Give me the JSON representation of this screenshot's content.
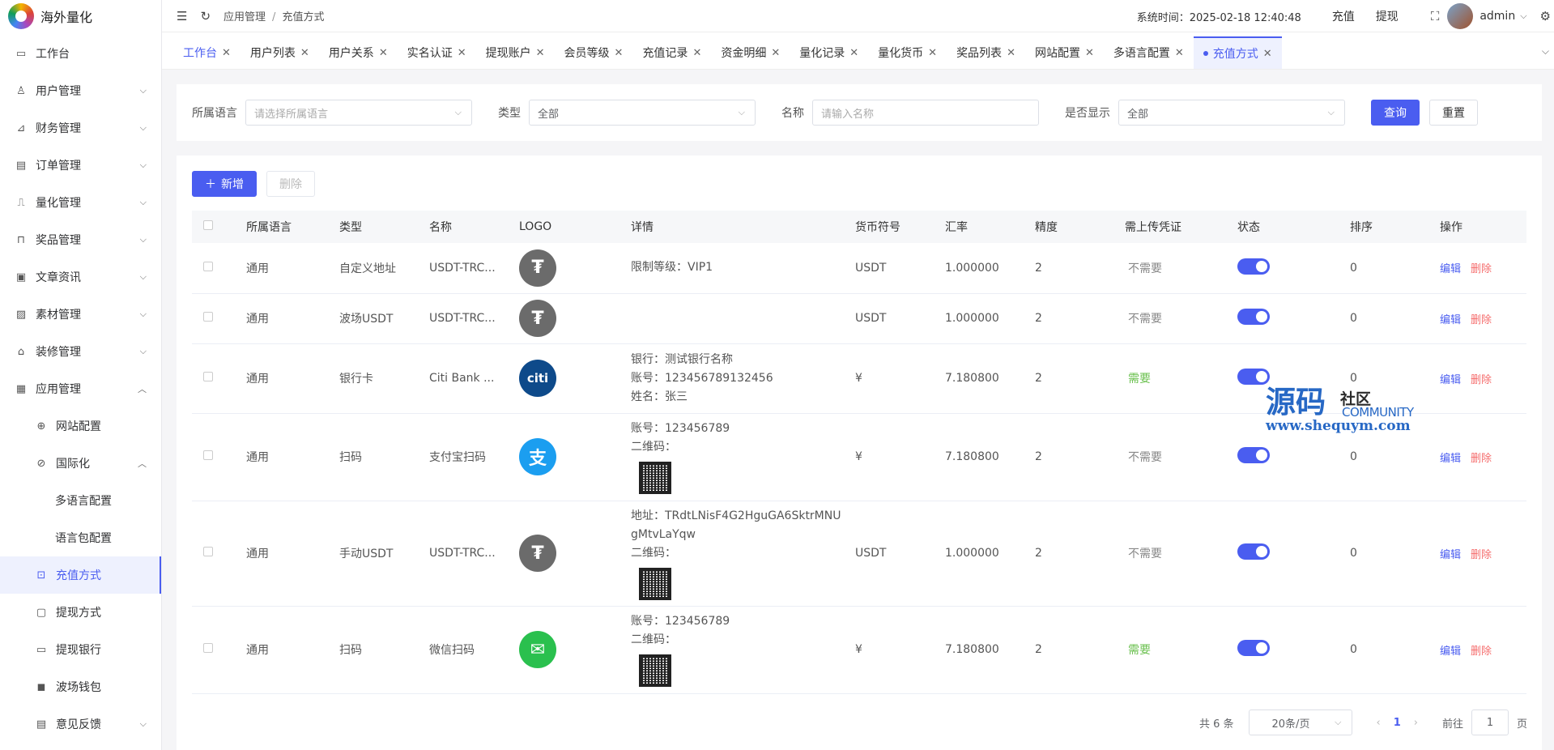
{
  "app": {
    "title": "海外量化"
  },
  "sidebar": {
    "items": [
      {
        "label": "工作台",
        "icon": "monitor-icon"
      },
      {
        "label": "用户管理",
        "icon": "user-icon"
      },
      {
        "label": "财务管理",
        "icon": "chart-icon"
      },
      {
        "label": "订单管理",
        "icon": "order-icon"
      },
      {
        "label": "量化管理",
        "icon": "quant-icon"
      },
      {
        "label": "奖品管理",
        "icon": "bag-icon"
      },
      {
        "label": "文章资讯",
        "icon": "article-icon"
      },
      {
        "label": "素材管理",
        "icon": "image-icon"
      },
      {
        "label": "装修管理",
        "icon": "decor-icon"
      },
      {
        "label": "应用管理",
        "icon": "app-icon"
      }
    ],
    "app_sub": [
      {
        "label": "网站配置"
      },
      {
        "label": "国际化"
      }
    ],
    "i18n_sub": [
      {
        "label": "多语言配置"
      },
      {
        "label": "语言包配置"
      }
    ],
    "app_sub2": [
      {
        "label": "充值方式"
      },
      {
        "label": "提现方式"
      },
      {
        "label": "提现银行"
      },
      {
        "label": "波场钱包"
      },
      {
        "label": "意见反馈"
      }
    ]
  },
  "topbar": {
    "breadcrumb": [
      "应用管理",
      "充值方式"
    ],
    "breadcrumb_sep": "/",
    "system_time_label": "系统时间：",
    "system_time": "2025-02-18 12:40:48",
    "recharge": "充值",
    "withdraw": "提现",
    "user": "admin"
  },
  "tabs": [
    "工作台",
    "用户列表",
    "用户关系",
    "实名认证",
    "提现账户",
    "会员等级",
    "充值记录",
    "资金明细",
    "量化记录",
    "量化货币",
    "奖品列表",
    "网站配置",
    "多语言配置",
    "充值方式"
  ],
  "filter": {
    "lang_label": "所属语言",
    "lang_placeholder": "请选择所属语言",
    "type_label": "类型",
    "type_value": "全部",
    "name_label": "名称",
    "name_placeholder": "请输入名称",
    "show_label": "是否显示",
    "show_value": "全部",
    "query": "查询",
    "reset": "重置"
  },
  "toolbar": {
    "add": "新增",
    "delete": "删除"
  },
  "table": {
    "headers": [
      "所属语言",
      "类型",
      "名称",
      "LOGO",
      "详情",
      "货币符号",
      "汇率",
      "精度",
      "需上传凭证",
      "状态",
      "排序",
      "操作"
    ],
    "rows": [
      {
        "lang": "通用",
        "type": "自定义地址",
        "name": "USDT-TRC...",
        "logo": "tether-logo",
        "detail": [
          "限制等级：VIP1"
        ],
        "qr": false,
        "symbol": "USDT",
        "rate": "1.000000",
        "precision": "2",
        "voucher": "不需要",
        "voucher_need": false,
        "status": true,
        "sort": "0"
      },
      {
        "lang": "通用",
        "type": "波场USDT",
        "name": "USDT-TRC...",
        "logo": "tether-logo",
        "detail": [],
        "qr": false,
        "symbol": "USDT",
        "rate": "1.000000",
        "precision": "2",
        "voucher": "不需要",
        "voucher_need": false,
        "status": true,
        "sort": "0"
      },
      {
        "lang": "通用",
        "type": "银行卡",
        "name": "Citi Bank ...",
        "logo": "citi-logo",
        "detail": [
          "银行：测试银行名称",
          "账号：123456789132456",
          "姓名：张三"
        ],
        "qr": false,
        "symbol": "¥",
        "rate": "7.180800",
        "precision": "2",
        "voucher": "需要",
        "voucher_need": true,
        "status": true,
        "sort": "0"
      },
      {
        "lang": "通用",
        "type": "扫码",
        "name": "支付宝扫码",
        "logo": "alipay-logo",
        "detail": [
          "账号：123456789",
          "二维码："
        ],
        "qr": true,
        "symbol": "¥",
        "rate": "7.180800",
        "precision": "2",
        "voucher": "不需要",
        "voucher_need": false,
        "status": true,
        "sort": "0"
      },
      {
        "lang": "通用",
        "type": "手动USDT",
        "name": "USDT-TRC...",
        "logo": "tether-logo",
        "detail": [
          "地址：TRdtLNisF4G2HguGA6SktrMNU",
          "gMtvLaYqw",
          "二维码："
        ],
        "qr": true,
        "symbol": "USDT",
        "rate": "1.000000",
        "precision": "2",
        "voucher": "不需要",
        "voucher_need": false,
        "status": true,
        "sort": "0"
      },
      {
        "lang": "通用",
        "type": "扫码",
        "name": "微信扫码",
        "logo": "wechat-logo",
        "detail": [
          "账号：123456789",
          "二维码："
        ],
        "qr": true,
        "symbol": "¥",
        "rate": "7.180800",
        "precision": "2",
        "voucher": "需要",
        "voucher_need": true,
        "status": true,
        "sort": "0"
      }
    ],
    "edit": "编辑",
    "del": "删除"
  },
  "pager": {
    "total": "共 6 条",
    "size": "20条/页",
    "page": "1",
    "goto_label": "前往",
    "goto_value": "1",
    "page_unit": "页"
  },
  "watermark": {
    "big": "源码",
    "small": "社区",
    "community": "COMMUNITY",
    "url": "www.shequym.com"
  }
}
